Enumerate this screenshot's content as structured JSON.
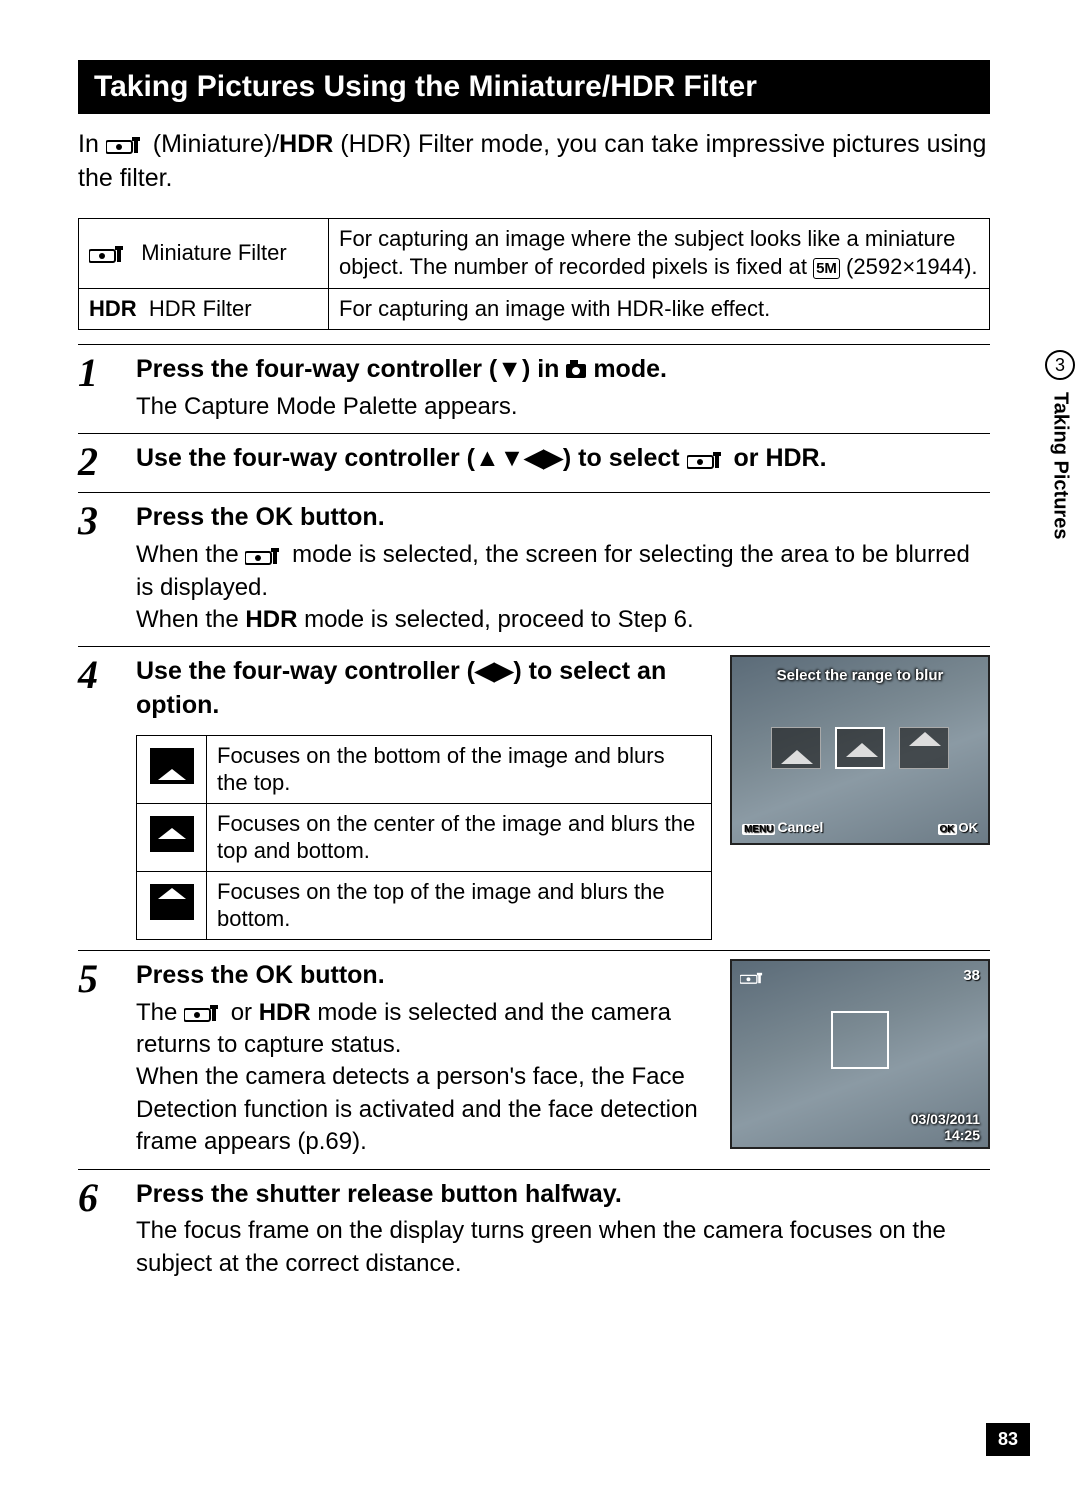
{
  "section_title": "Taking Pictures Using the Miniature/HDR Filter",
  "intro": {
    "prefix": "In ",
    "mid1": " (Miniature)/",
    "hdr": "HDR",
    "suffix": " (HDR) Filter mode, you can take impressive pictures using the filter."
  },
  "mode_table": {
    "r1_label": "Miniature Filter",
    "r1_desc_a": "For capturing an image where the subject looks like a miniature object. The number of recorded pixels is fixed at ",
    "r1_pill": "5M",
    "r1_desc_b": " (2592×1944).",
    "r2_hdr": "HDR",
    "r2_label": "HDR Filter",
    "r2_desc": "For capturing an image with HDR-like effect."
  },
  "steps": {
    "s1": {
      "num": "1",
      "head_a": "Press the four-way controller (▼) in ",
      "head_b": " mode.",
      "text": "The Capture Mode Palette appears."
    },
    "s2": {
      "num": "2",
      "head_a": "Use the four-way controller (▲▼◀▶) to select ",
      "head_b": " or ",
      "hdr": "HDR",
      "head_c": "."
    },
    "s3": {
      "num": "3",
      "head_a": "Press the ",
      "ok": "OK",
      "head_b": " button.",
      "text_a": "When the ",
      "text_b": " mode is selected, the screen for selecting the area to be blurred is displayed.",
      "text_c": "When the ",
      "hdr": "HDR",
      "text_d": " mode is selected, proceed to Step 6."
    },
    "s4": {
      "num": "4",
      "head": "Use the four-way controller (◀▶) to select an option.",
      "opt1": "Focuses on the bottom of the image and blurs the top.",
      "opt2": "Focuses on the center of the image and blurs the top and bottom.",
      "opt3": "Focuses on the top of the image and blurs the bottom."
    },
    "s5": {
      "num": "5",
      "head_a": "Press the ",
      "ok": "OK",
      "head_b": " button.",
      "text_a": "The ",
      "text_b": " or ",
      "hdr": "HDR",
      "text_c": " mode is selected and the camera returns to capture status.",
      "text_d": "When the camera detects a person's face, the Face Detection function is activated and the face detection frame appears (p.69)."
    },
    "s6": {
      "num": "6",
      "head": "Press the shutter release button halfway.",
      "text": "The focus frame on the display turns green when the camera focuses on the subject at the correct distance."
    }
  },
  "screenshots": {
    "s4": {
      "title": "Select the range to blur",
      "menu": "MENU",
      "cancel": "Cancel",
      "okbox": "OK",
      "ok": "OK"
    },
    "s5": {
      "count": "38",
      "date": "03/03/2011",
      "time": "14:25"
    }
  },
  "sidebar": {
    "chapter": "3",
    "label": "Taking Pictures"
  },
  "page_number": "83"
}
